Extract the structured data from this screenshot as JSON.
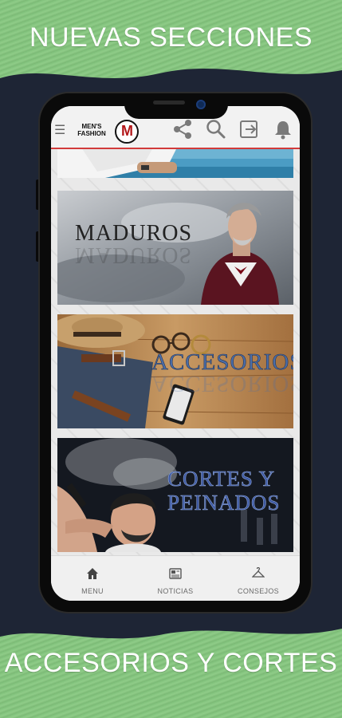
{
  "promo": {
    "top_headline": "NUEVAS SECCIONES",
    "bottom_headline": "ACCESORIOS Y CORTES"
  },
  "app": {
    "logo_text": "MEN'S FASHION",
    "logo_letter": "M"
  },
  "header_icons": [
    "menu-icon",
    "share-icon",
    "search-icon",
    "exit-icon",
    "bell-icon"
  ],
  "sections": [
    {
      "label": ""
    },
    {
      "label": "MADUROS"
    },
    {
      "label": "ACCESORIOS"
    },
    {
      "label_line1": "CORTES Y",
      "label_line2": "PEINADOS"
    }
  ],
  "bottom_nav": [
    {
      "label": "MENU",
      "icon": "home-icon"
    },
    {
      "label": "NOTICIAS",
      "icon": "news-icon"
    },
    {
      "label": "CONSEJOS",
      "icon": "hanger-icon"
    }
  ],
  "colors": {
    "accent_red": "#d23a3a",
    "promo_green": "#8fcc88",
    "background_navy": "#1e2535"
  }
}
